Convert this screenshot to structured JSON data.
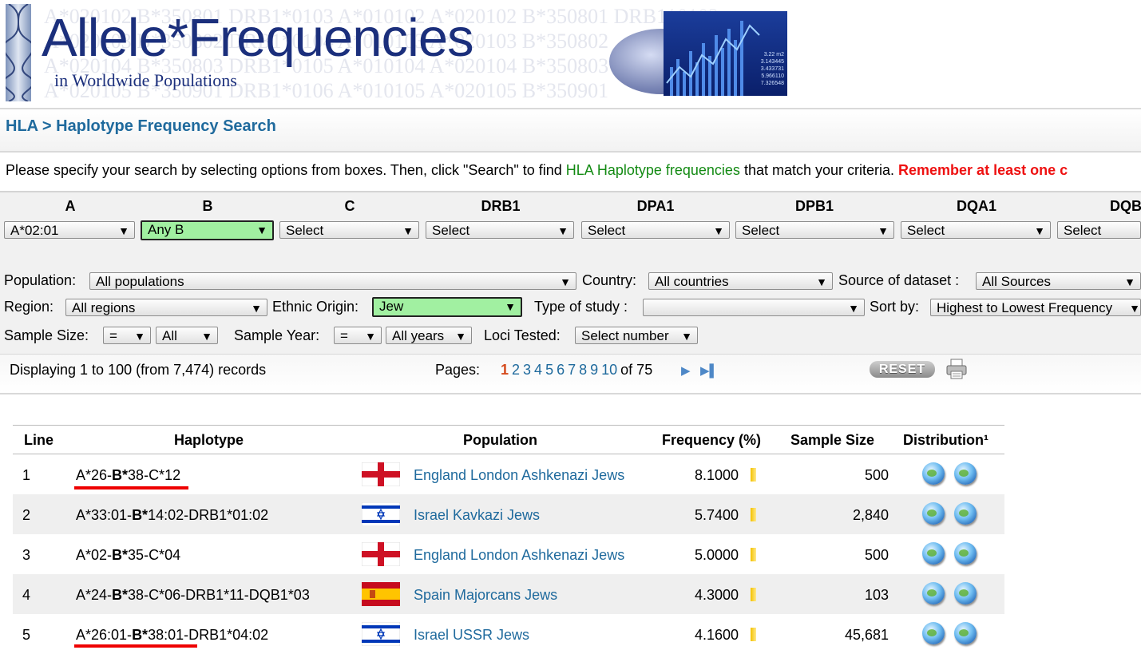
{
  "site": {
    "title": "Allele*Frequencies",
    "subtitle": "in Worldwide Populations",
    "bg_alleles": [
      "A*020102  B*350801  DRB1*0103  A*010102  A*020102  B*350801 DRB1*0103",
      "A*020103  B*350802  DRB1*0104  A*010103  A*020103  B*350802",
      "A*020104  B*350803  DRB1*0105  A*010104  A*020104  B*350803",
      "A*020105  B*350901  DRB1*0106  A*010105  A*020105  B*350901"
    ],
    "stock_lines": [
      "3.22 m2",
      "3.143445",
      "3.433731",
      "5.966110",
      "7.326548"
    ]
  },
  "breadcrumb": "HLA > Haplotype Frequency Search",
  "intro": {
    "text1": "Please specify your search by selecting options from boxes. Then, click \"Search\" to find ",
    "link": "HLA Haplotype frequencies",
    "text2": " that match your criteria. ",
    "warning": "Remember at least one c"
  },
  "loci": [
    {
      "name": "A",
      "value": "A*02:01"
    },
    {
      "name": "B",
      "value": "Any B"
    },
    {
      "name": "C",
      "value": "Select"
    },
    {
      "name": "DRB1",
      "value": "Select"
    },
    {
      "name": "DPA1",
      "value": "Select"
    },
    {
      "name": "DPB1",
      "value": "Select"
    },
    {
      "name": "DQA1",
      "value": "Select"
    },
    {
      "name": "DQB",
      "value": "Select"
    }
  ],
  "filters": {
    "population_label": "Population:",
    "population": "All populations",
    "country_label": "Country:",
    "country": "All countries",
    "source_label": "Source of dataset :",
    "source": "All Sources",
    "region_label": "Region:",
    "region": "All regions",
    "ethnic_label": "Ethnic Origin:",
    "ethnic": "Jew",
    "study_label": "Type of study :",
    "study": "",
    "sort_label": "Sort by:",
    "sort": "Highest to Lowest Frequency",
    "sample_size_label": "Sample Size:",
    "sample_size_op": "=",
    "sample_size": "All",
    "sample_year_label": "Sample Year:",
    "sample_year_op": "=",
    "sample_year": "All years",
    "loci_label": "Loci Tested:",
    "loci": "Select number"
  },
  "paging": {
    "records": "Displaying 1 to 100 (from 7,474) records",
    "pages_label": "Pages:",
    "current": "1",
    "pages": [
      "2",
      "3",
      "4",
      "5",
      "6",
      "7",
      "8",
      "9",
      "10"
    ],
    "of_total": "of 75",
    "reset": "RESET"
  },
  "table": {
    "headers": {
      "line": "Line",
      "haplotype": "Haplotype",
      "population": "Population",
      "frequency": "Frequency (%)",
      "sample_size": "Sample Size",
      "distribution": "Distribution¹"
    },
    "rows": [
      {
        "line": "1",
        "hap_pre": "A*26-",
        "hap_b": "B*",
        "hap_post": "38-C*12",
        "flag": "england",
        "population": "England London Ashkenazi Jews",
        "frequency": "8.1000",
        "sample_size": "500",
        "underlined": true
      },
      {
        "line": "2",
        "hap_pre": "A*33:01-",
        "hap_b": "B*",
        "hap_post": "14:02-DRB1*01:02",
        "flag": "israel",
        "population": "Israel Kavkazi Jews",
        "frequency": "5.7400",
        "sample_size": "2,840",
        "underlined": false
      },
      {
        "line": "3",
        "hap_pre": "A*02-",
        "hap_b": "B*",
        "hap_post": "35-C*04",
        "flag": "england",
        "population": "England London Ashkenazi Jews",
        "frequency": "5.0000",
        "sample_size": "500",
        "underlined": false
      },
      {
        "line": "4",
        "hap_pre": "A*24-",
        "hap_b": "B*",
        "hap_post": "38-C*06-DRB1*11-DQB1*03",
        "flag": "spain",
        "population": "Spain Majorcans Jews",
        "frequency": "4.3000",
        "sample_size": "103",
        "underlined": false
      },
      {
        "line": "5",
        "hap_pre": "A*26:01-",
        "hap_b": "B*",
        "hap_post": "38:01-DRB1*04:02",
        "flag": "israel",
        "population": "Israel USSR Jews",
        "frequency": "4.1600",
        "sample_size": "45,681",
        "underlined": true
      }
    ]
  },
  "colors": {
    "brand": "#1b2f7c",
    "link": "#1f6a9d",
    "highlight": "#a1f0a1",
    "warning": "#ee1111",
    "annotation": "#ee0000"
  }
}
